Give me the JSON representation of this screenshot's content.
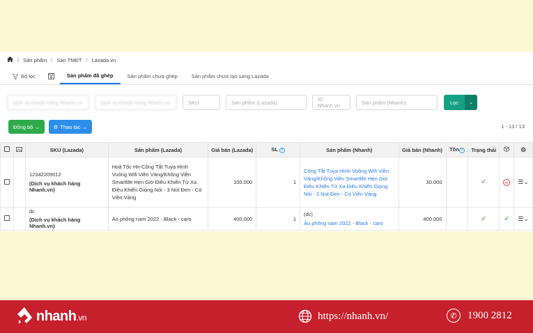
{
  "breadcrumb": [
    "Sản phẩm",
    "Sàn TMĐT",
    "Lazada.vn"
  ],
  "tabs": {
    "filter": "Bộ lọc",
    "matched": "Sản phẩm đã ghép",
    "unmatched": "Sản phẩm chưa ghép",
    "not_created": "Sản phẩm chưa tạo sang Lazada"
  },
  "filters": {
    "f1": "Dịch vụ khách hàng Nhanh.vn",
    "f2": "Dịch vụ khách hàng Nhanh.vn",
    "sku": "SKU",
    "product_lazada": "Sản phẩm (Lazada)",
    "id_nhanh": "ID Nhanh.vn",
    "product_nhanh": "Sản phẩm (Nhanh)",
    "filter_button": "Lọc"
  },
  "actions": {
    "sync": "Đồng bộ",
    "operations": "Thao tác",
    "pager": "1 - 13 / 13"
  },
  "table": {
    "headers": {
      "sku": "SKU (Lazada)",
      "product_lazada": "Sản phẩm (Lazada)",
      "price_lazada": "Giá bán (Lazada)",
      "qty": "SL",
      "product_nhanh": "Sản phẩm (Nhanh)",
      "price_nhanh": "Giá bán (Nhanh)",
      "stock": "Tồn",
      "status": "Trạng thái"
    },
    "rows": [
      {
        "sku": "12342209012",
        "shop": "(Dịch vụ khách hàng Nhanh.vn)",
        "product_lazada": "Hoả Tốc Hn-Công Tắt Tuya Hình Vuông Wifi Viền Vàng/Không Viền Smartlife Hẹn Giờ Điều Khiển Từ Xa Điều Khiển Giọng Nói - 3 Nút Đen - Có Viền Vàng",
        "price_lazada": "100.000",
        "qty": "1",
        "nhanh_code": "",
        "product_nhanh": "Công Tắt Tuya Hình Vuông Wifi Viền Vàng/Không Viền Smartlife Hẹn Giờ Điều Khiển Từ Xa Điều Khiển Giọng Nói - 3 Nút Đen - Có Viền Vàng",
        "price_nhanh": "30.000"
      },
      {
        "sku": "dc",
        "shop": "(Dịch vụ khách hàng Nhanh.vn)",
        "product_lazada": "Áo phông nam 2022 - Black - caro",
        "price_lazada": "400.000",
        "qty": "1",
        "nhanh_code": "(dc)",
        "product_nhanh": "Áo phông nam 2022 - Black - caro",
        "price_nhanh": "400.000"
      }
    ]
  },
  "footer": {
    "logo": "nhanh",
    "logo_suffix": ".vn",
    "website": "https://nhanh.vn/",
    "phone": "1900 2812"
  },
  "colors": {
    "accent": "#2d8ee8",
    "green": "#2eaa4a",
    "footer": "#c7202d",
    "background": "#fdf8d2"
  }
}
